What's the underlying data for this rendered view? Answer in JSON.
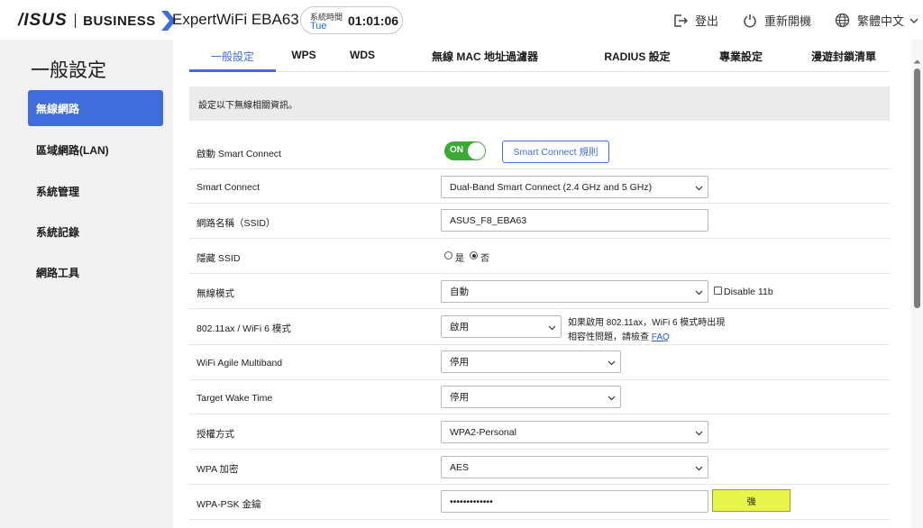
{
  "header": {
    "brand": "/ISUS",
    "brand_line": "BUSINESS",
    "product": "ExpertWiFi EBA63",
    "clock_label": "系統時間",
    "clock_day": "Tue",
    "clock_time": "01:01:06",
    "logout": "登出",
    "reboot": "重新開機",
    "language": "繁體中文"
  },
  "sidebar": {
    "title": "一般設定",
    "items": [
      {
        "label": "無線網路"
      },
      {
        "label": "區域網路(LAN)"
      },
      {
        "label": "系統管理"
      },
      {
        "label": "系統記錄"
      },
      {
        "label": "網路工具"
      }
    ]
  },
  "tabs": [
    {
      "label": "一般設定"
    },
    {
      "label": "WPS"
    },
    {
      "label": "WDS"
    },
    {
      "label": "無線 MAC 地址過濾器"
    },
    {
      "label": "RADIUS 設定"
    },
    {
      "label": "專業設定"
    },
    {
      "label": "漫遊封鎖清單"
    }
  ],
  "info": "設定以下無線相關資訊。",
  "form": {
    "smart_connect_enable": {
      "label": "啟動 Smart Connect",
      "toggle": "ON",
      "rule_button": "Smart Connect 規則"
    },
    "smart_connect": {
      "label": "Smart Connect",
      "value": "Dual-Band Smart Connect (2.4 GHz and 5 GHz)"
    },
    "ssid": {
      "label": "網路名稱（SSID）",
      "value": "ASUS_F8_EBA63"
    },
    "hide_ssid": {
      "label": "隱藏 SSID",
      "yes": "是",
      "no": "否"
    },
    "wireless_mode": {
      "label": "無線模式",
      "value": "自動",
      "disable11b": "Disable 11b"
    },
    "ax_mode": {
      "label": "802.11ax / WiFi 6 模式",
      "value": "啟用",
      "note_line1": "如果啟用 802.11ax，WiFi 6 模式時出現",
      "note_line2": "相容性問題，請檢查",
      "faq": "FAQ"
    },
    "agile_multiband": {
      "label": "WiFi Agile Multiband",
      "value": "停用"
    },
    "twt": {
      "label": "Target Wake Time",
      "value": "停用"
    },
    "auth": {
      "label": "授權方式",
      "value": "WPA2-Personal"
    },
    "wpa_encrypt": {
      "label": "WPA 加密",
      "value": "AES"
    },
    "psk": {
      "label": "WPA-PSK 金鑰",
      "value": "•••••••••••••",
      "strength": "強"
    }
  },
  "colors": {
    "accent": "#3f6ddb",
    "toggle_on": "#3aa935",
    "strength": "#e7f54a"
  }
}
